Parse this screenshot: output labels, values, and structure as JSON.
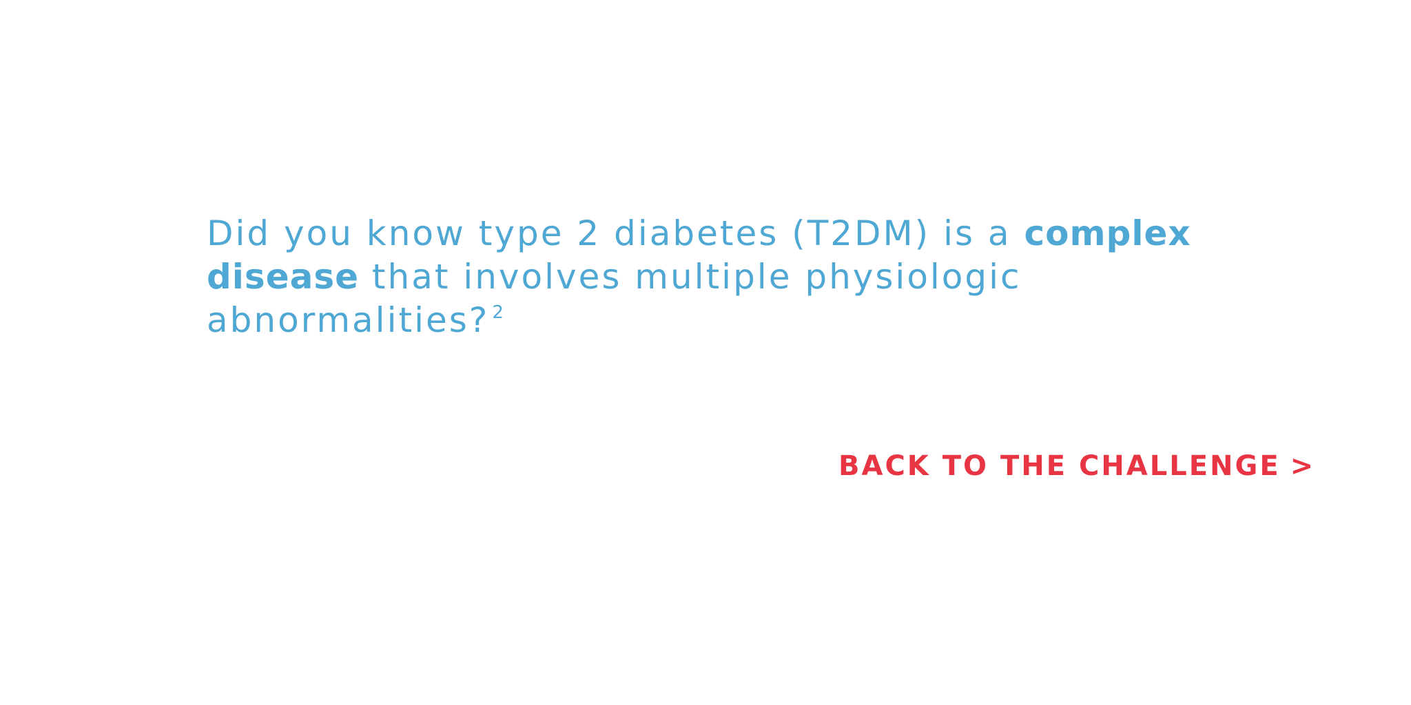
{
  "fact": {
    "part1": "Did you know type 2 diabetes (T2DM) is a ",
    "bold1": "complex",
    "bold2": "disease",
    "part2": " that involves multiple physiologic abnormalities?",
    "footnote": "2"
  },
  "back_link": {
    "label": "BACK TO THE CHALLENGE",
    "chevron": ">"
  },
  "colors": {
    "text_blue": "#4fa7d3",
    "link_red": "#e83544",
    "background": "#ffffff"
  }
}
